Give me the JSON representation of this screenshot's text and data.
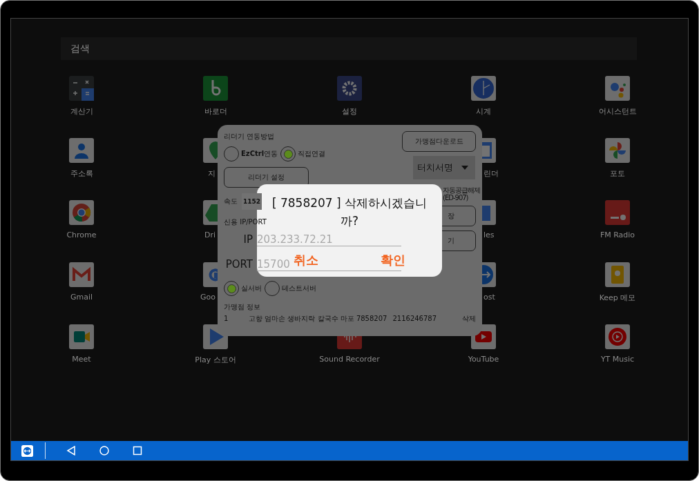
{
  "search": {
    "placeholder": "검색"
  },
  "app_rows": [
    {
      "apps": [
        {
          "label": "계산기"
        },
        {
          "label": "바로더"
        },
        {
          "label": "설정"
        },
        {
          "label": "시계"
        },
        {
          "label": "어시스턴트"
        }
      ]
    },
    {
      "apps": [
        {
          "label": "주소록"
        },
        {
          "label": "지"
        },
        {
          "label": "린더"
        },
        {
          "label": "포토"
        }
      ]
    },
    {
      "apps": [
        {
          "label": "Chrome"
        },
        {
          "label": "Dri"
        },
        {
          "label": "les"
        },
        {
          "label": "FM Radio"
        }
      ]
    },
    {
      "apps": [
        {
          "label": "Gmail"
        },
        {
          "label": "Goo"
        },
        {
          "label": "ost"
        },
        {
          "label": "Keep 메모"
        }
      ]
    },
    {
      "apps": [
        {
          "label": "Meet"
        },
        {
          "label": "Play 스토어"
        },
        {
          "label": "Sound Recorder"
        },
        {
          "label": "YouTube"
        },
        {
          "label": "YT Music"
        }
      ]
    }
  ],
  "settings_dialog": {
    "connection_label": "리더기 연동방법",
    "connection_options": [
      {
        "label": "**EzCtrl**연동",
        "selected": false
      },
      {
        "label": "직접연결",
        "selected": true
      }
    ],
    "reader_settings_button": "리더기 설정",
    "speed_label": "속도",
    "speed_value": "1152",
    "download_button": "가맹점다운로드",
    "signature_dropdown": "터치서명",
    "auto_supply_label": "자동공급해제(ED-907)",
    "credit_label": "신용 IP/PORT",
    "ip_label": "IP",
    "ip_value": "203.233.72.21",
    "port_label": "PORT",
    "port_value": "15700",
    "save_button": "장",
    "close_button": "기",
    "server_options": [
      {
        "label": "실서버",
        "selected": true
      },
      {
        "label": "테스트서버",
        "selected": false
      }
    ],
    "merchant_label": "가맹점 정보",
    "merchants": [
      {
        "number": "1",
        "name": "고향 엄마손 생바지락 칼국수 마포 7858207",
        "business_no": "2116246787",
        "action": "삭제"
      }
    ]
  },
  "confirm_dialog": {
    "message": "[ 7858207 ] 삭제하시겠습니까?",
    "buttons": [
      {
        "label": "취소"
      },
      {
        "label": "확인"
      }
    ]
  }
}
